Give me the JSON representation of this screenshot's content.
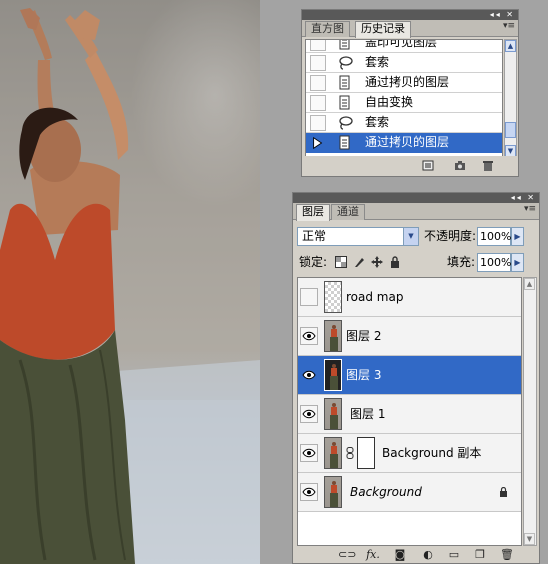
{
  "history_panel": {
    "tabs": [
      {
        "label": "直方图",
        "active": false
      },
      {
        "label": "历史记录",
        "active": true
      }
    ],
    "items": [
      {
        "label": "盖印可见图层",
        "icon": "document-icon",
        "selected": false
      },
      {
        "label": "套索",
        "icon": "lasso-icon",
        "selected": false
      },
      {
        "label": "通过拷贝的图层",
        "icon": "document-icon",
        "selected": false
      },
      {
        "label": "自由变换",
        "icon": "document-icon",
        "selected": false
      },
      {
        "label": "套索",
        "icon": "lasso-icon",
        "selected": false
      },
      {
        "label": "通过拷贝的图层",
        "icon": "document-icon",
        "selected": true
      }
    ]
  },
  "layers_panel": {
    "tabs": [
      {
        "label": "图层",
        "active": true
      },
      {
        "label": "通道",
        "active": false
      }
    ],
    "blend_mode": "正常",
    "opacity_label": "不透明度:",
    "opacity_value": "100%",
    "lock_label": "锁定:",
    "fill_label": "填充:",
    "fill_value": "100%",
    "layers": [
      {
        "name": "road map",
        "visible": false,
        "thumb": "transparent",
        "selected": false,
        "italic": false,
        "locked": false,
        "has_mask": false
      },
      {
        "name": "图层 2",
        "visible": true,
        "thumb": "person",
        "selected": false,
        "italic": false,
        "locked": false,
        "has_mask": false
      },
      {
        "name": "图层 3",
        "visible": true,
        "thumb": "person",
        "selected": true,
        "italic": false,
        "locked": false,
        "has_mask": false
      },
      {
        "name": "图层 1",
        "visible": true,
        "thumb": "person",
        "selected": false,
        "italic": false,
        "locked": false,
        "has_mask": false
      },
      {
        "name": "Background 副本",
        "visible": true,
        "thumb": "person",
        "selected": false,
        "italic": false,
        "locked": false,
        "has_mask": true
      },
      {
        "name": "Background",
        "visible": true,
        "thumb": "person",
        "selected": false,
        "italic": true,
        "locked": true,
        "has_mask": false
      }
    ],
    "bottom_icons": [
      "link-icon",
      "fx-icon",
      "add-mask-icon",
      "adjustment-layer-icon",
      "new-group-icon",
      "new-layer-icon",
      "trash-icon"
    ]
  },
  "colors": {
    "selection": "#3169c6",
    "panel_bg": "#d4d0c8",
    "workspace_bg": "#a3a3a3",
    "top_color": "#bd4a2a",
    "skirt_color": "#4a5038"
  }
}
